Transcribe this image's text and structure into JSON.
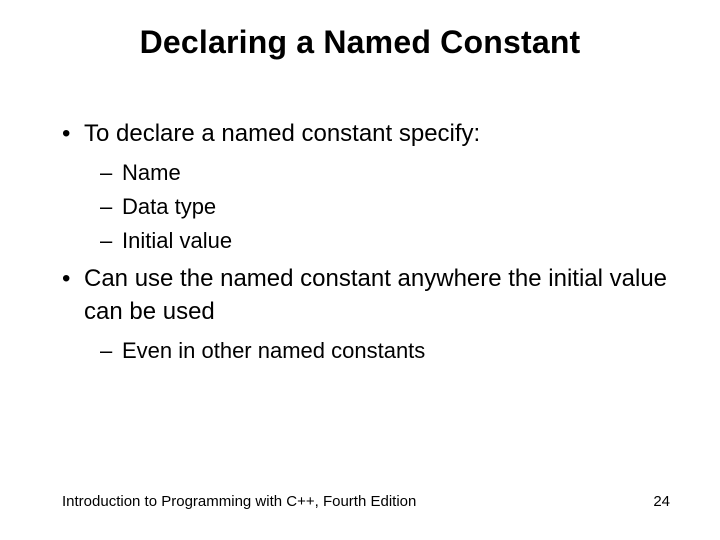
{
  "title": "Declaring a Named Constant",
  "bullets": {
    "b1a": "To declare a named constant specify:",
    "b2a": "Name",
    "b2b": "Data type",
    "b2c": "Initial value",
    "b1b": "Can use the named constant anywhere the initial value can be used",
    "b2d": "Even in other named constants"
  },
  "footer": {
    "left": "Introduction to Programming with C++, Fourth Edition",
    "right": "24"
  }
}
